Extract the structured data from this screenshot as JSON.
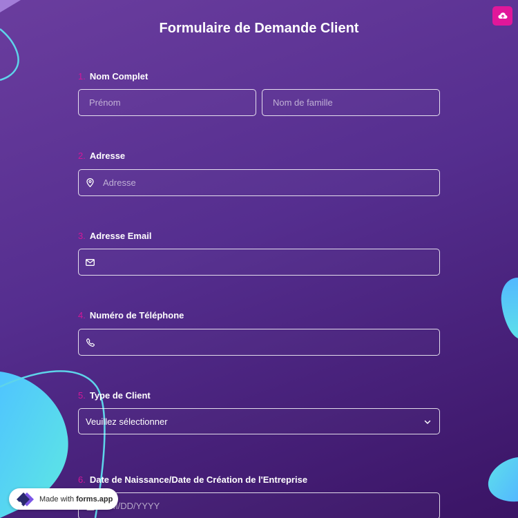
{
  "form": {
    "title": "Formulaire de Demande Client",
    "questions": [
      {
        "number": "1.",
        "label": "Nom Complet",
        "fields": [
          {
            "placeholder": "Prénom"
          },
          {
            "placeholder": "Nom de famille"
          }
        ]
      },
      {
        "number": "2.",
        "label": "Adresse",
        "placeholder": "Adresse"
      },
      {
        "number": "3.",
        "label": "Adresse Email",
        "placeholder": ""
      },
      {
        "number": "4.",
        "label": "Numéro de Téléphone",
        "placeholder": ""
      },
      {
        "number": "5.",
        "label": "Type de Client",
        "selected": "Veuillez sélectionner"
      },
      {
        "number": "6.",
        "label": "Date de Naissance/Date de Création de l'Entreprise",
        "placeholder": "MM/DD/YYYY"
      }
    ]
  },
  "badge": {
    "prefix": "Made with",
    "brand": "forms.app"
  },
  "colors": {
    "accent": "#e0179a",
    "background": "#552e8f",
    "number": "#d4179a",
    "decor": "#5ed4ea"
  },
  "icons": {
    "save": "cloud-upload-icon",
    "address": "map-pin-icon",
    "email": "envelope-icon",
    "phone": "phone-icon",
    "select": "chevron-down-icon",
    "date": "calendar-icon",
    "brand": "forms-app-logo-icon"
  }
}
